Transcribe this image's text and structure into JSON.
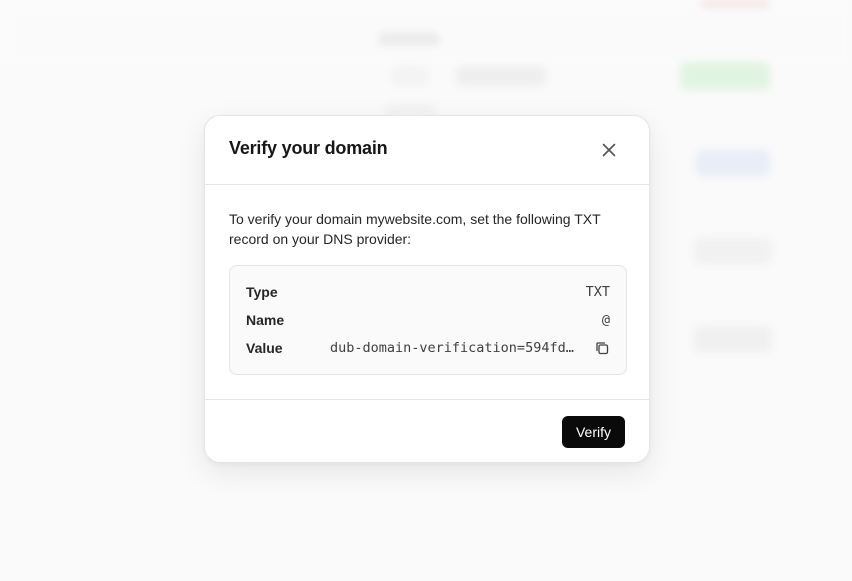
{
  "dialog": {
    "title": "Verify your domain",
    "close_icon": "close-icon",
    "intro": "To verify your domain mywebsite.com, set the following TXT record on your DNS provider:",
    "records": [
      {
        "label": "Type",
        "value": "TXT"
      },
      {
        "label": "Name",
        "value": "@"
      },
      {
        "label": "Value",
        "value": "dub-domain-verification=594fd…",
        "copy_icon": "copy-icon"
      }
    ],
    "verify_label": "Verify"
  },
  "colors": {
    "primary_button": "#0a0a0a",
    "background": "#fafafa",
    "border": "#e5e5e5",
    "bg_accent_green": "#b7ecb8",
    "bg_accent_blue": "#c9d8f5",
    "bg_accent_red": "#f2c6c6"
  }
}
